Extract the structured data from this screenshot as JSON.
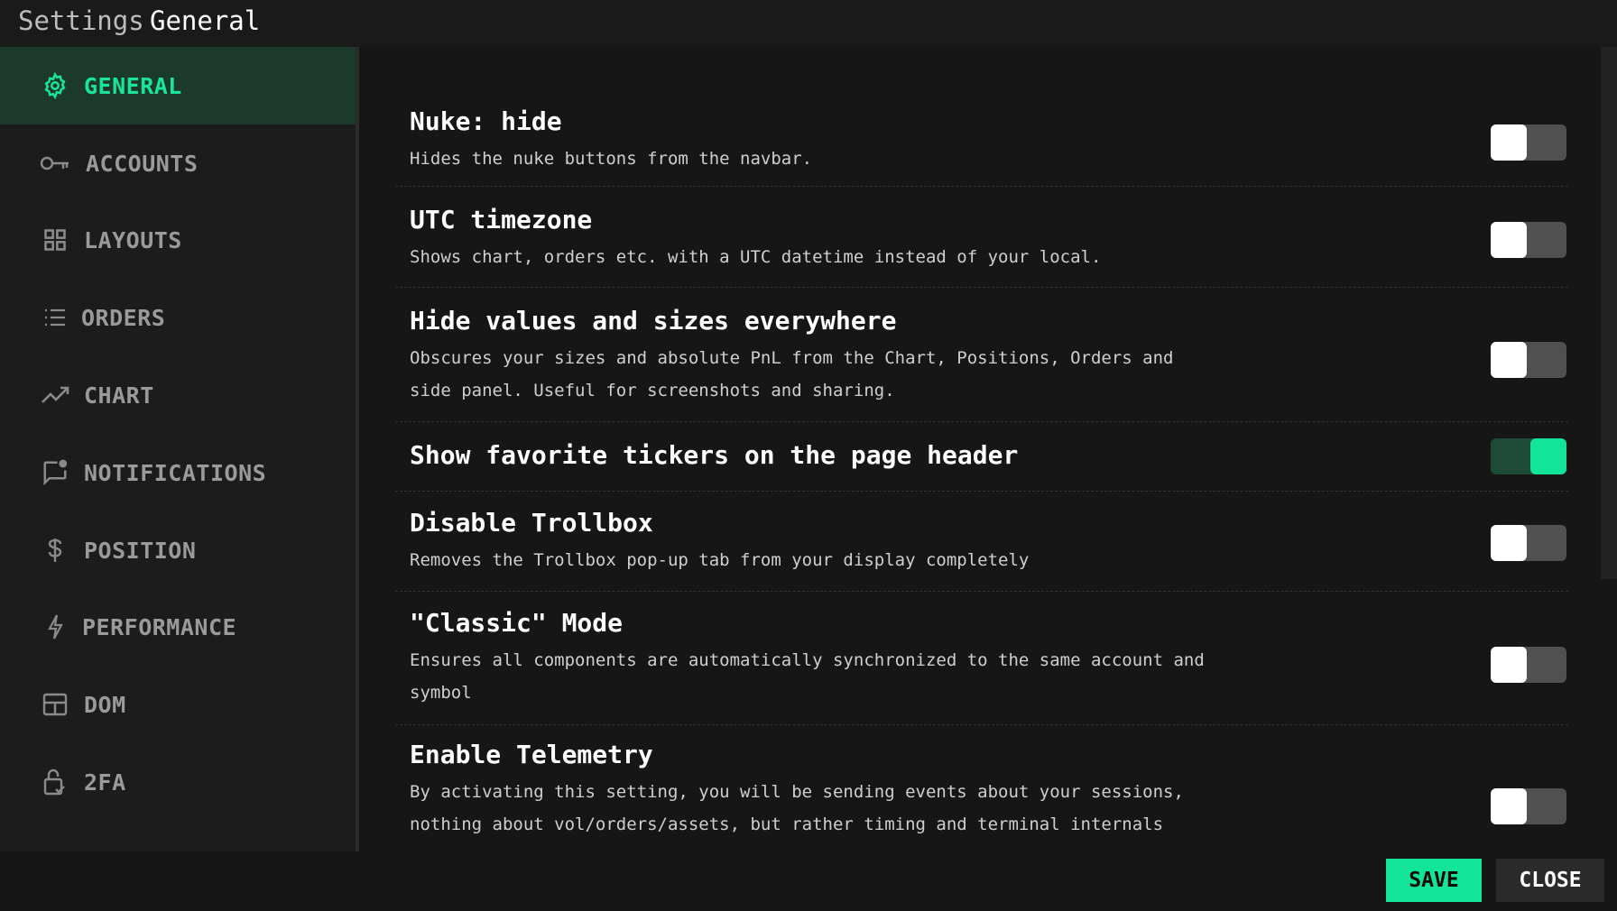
{
  "title": {
    "prefix": "Settings",
    "current": "General"
  },
  "accent_color": "#12e59a",
  "sidebar": {
    "items": [
      {
        "label": "GENERAL",
        "icon": "gear-icon",
        "active": true
      },
      {
        "label": "ACCOUNTS",
        "icon": "key-icon",
        "active": false
      },
      {
        "label": "LAYOUTS",
        "icon": "grid-icon",
        "active": false
      },
      {
        "label": "ORDERS",
        "icon": "list-icon",
        "active": false
      },
      {
        "label": "CHART",
        "icon": "trend-line-icon",
        "active": false
      },
      {
        "label": "NOTIFICATIONS",
        "icon": "message-badge-icon",
        "active": false
      },
      {
        "label": "POSITION",
        "icon": "dollar-icon",
        "active": false
      },
      {
        "label": "PERFORMANCE",
        "icon": "lightning-icon",
        "active": false
      },
      {
        "label": "DOM",
        "icon": "table-icon",
        "active": false
      },
      {
        "label": "2FA",
        "icon": "lock-icon",
        "active": false
      }
    ]
  },
  "settings": [
    {
      "title": "Nuke: hide",
      "description": "Hides the nuke buttons from the navbar.",
      "enabled": false
    },
    {
      "title": "UTC timezone",
      "description": "Shows chart, orders etc. with a UTC datetime instead of your local.",
      "enabled": false
    },
    {
      "title": "Hide values and sizes everywhere",
      "description": "Obscures your sizes and absolute PnL from the Chart, Positions, Orders and side panel. Useful for screenshots and sharing.",
      "enabled": false
    },
    {
      "title": "Show favorite tickers on the page header",
      "description": "",
      "enabled": true
    },
    {
      "title": "Disable Trollbox",
      "description": "Removes the Trollbox pop-up tab from your display completely",
      "enabled": false
    },
    {
      "title": "\"Classic\" Mode",
      "description": "Ensures all components are automatically synchronized to the same account and symbol",
      "enabled": false
    },
    {
      "title": "Enable Telemetry",
      "description": "By activating this setting, you will be sending events about your sessions, nothing about vol/orders/assets, but rather timing and terminal internals",
      "enabled": false
    }
  ],
  "footer": {
    "save_label": "SAVE",
    "close_label": "CLOSE"
  }
}
